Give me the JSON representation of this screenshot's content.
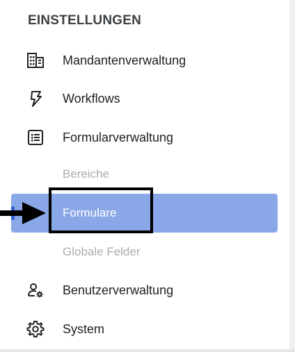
{
  "sidebar": {
    "section_title": "EINSTELLUNGEN",
    "items": [
      {
        "label": "Mandantenverwaltung",
        "icon": "building-icon"
      },
      {
        "label": "Workflows",
        "icon": "workflow-bolt-icon"
      },
      {
        "label": "Formularverwaltung",
        "icon": "list-icon"
      },
      {
        "label": "Benutzerverwaltung",
        "icon": "user-settings-icon"
      },
      {
        "label": "System",
        "icon": "gear-icon"
      }
    ],
    "sub_items": [
      {
        "label": "Bereiche",
        "active": false
      },
      {
        "label": "Formulare",
        "active": true
      },
      {
        "label": "Globale Felder",
        "active": false
      }
    ]
  },
  "colors": {
    "active_background": "#8aa8e8",
    "active_indicator": "#2f62d8",
    "sub_item_text": "#a8acb0",
    "annotation": "#000000"
  },
  "annotations": {
    "arrow": "pointing-right-arrow",
    "highlight": "box-around-formulare"
  }
}
